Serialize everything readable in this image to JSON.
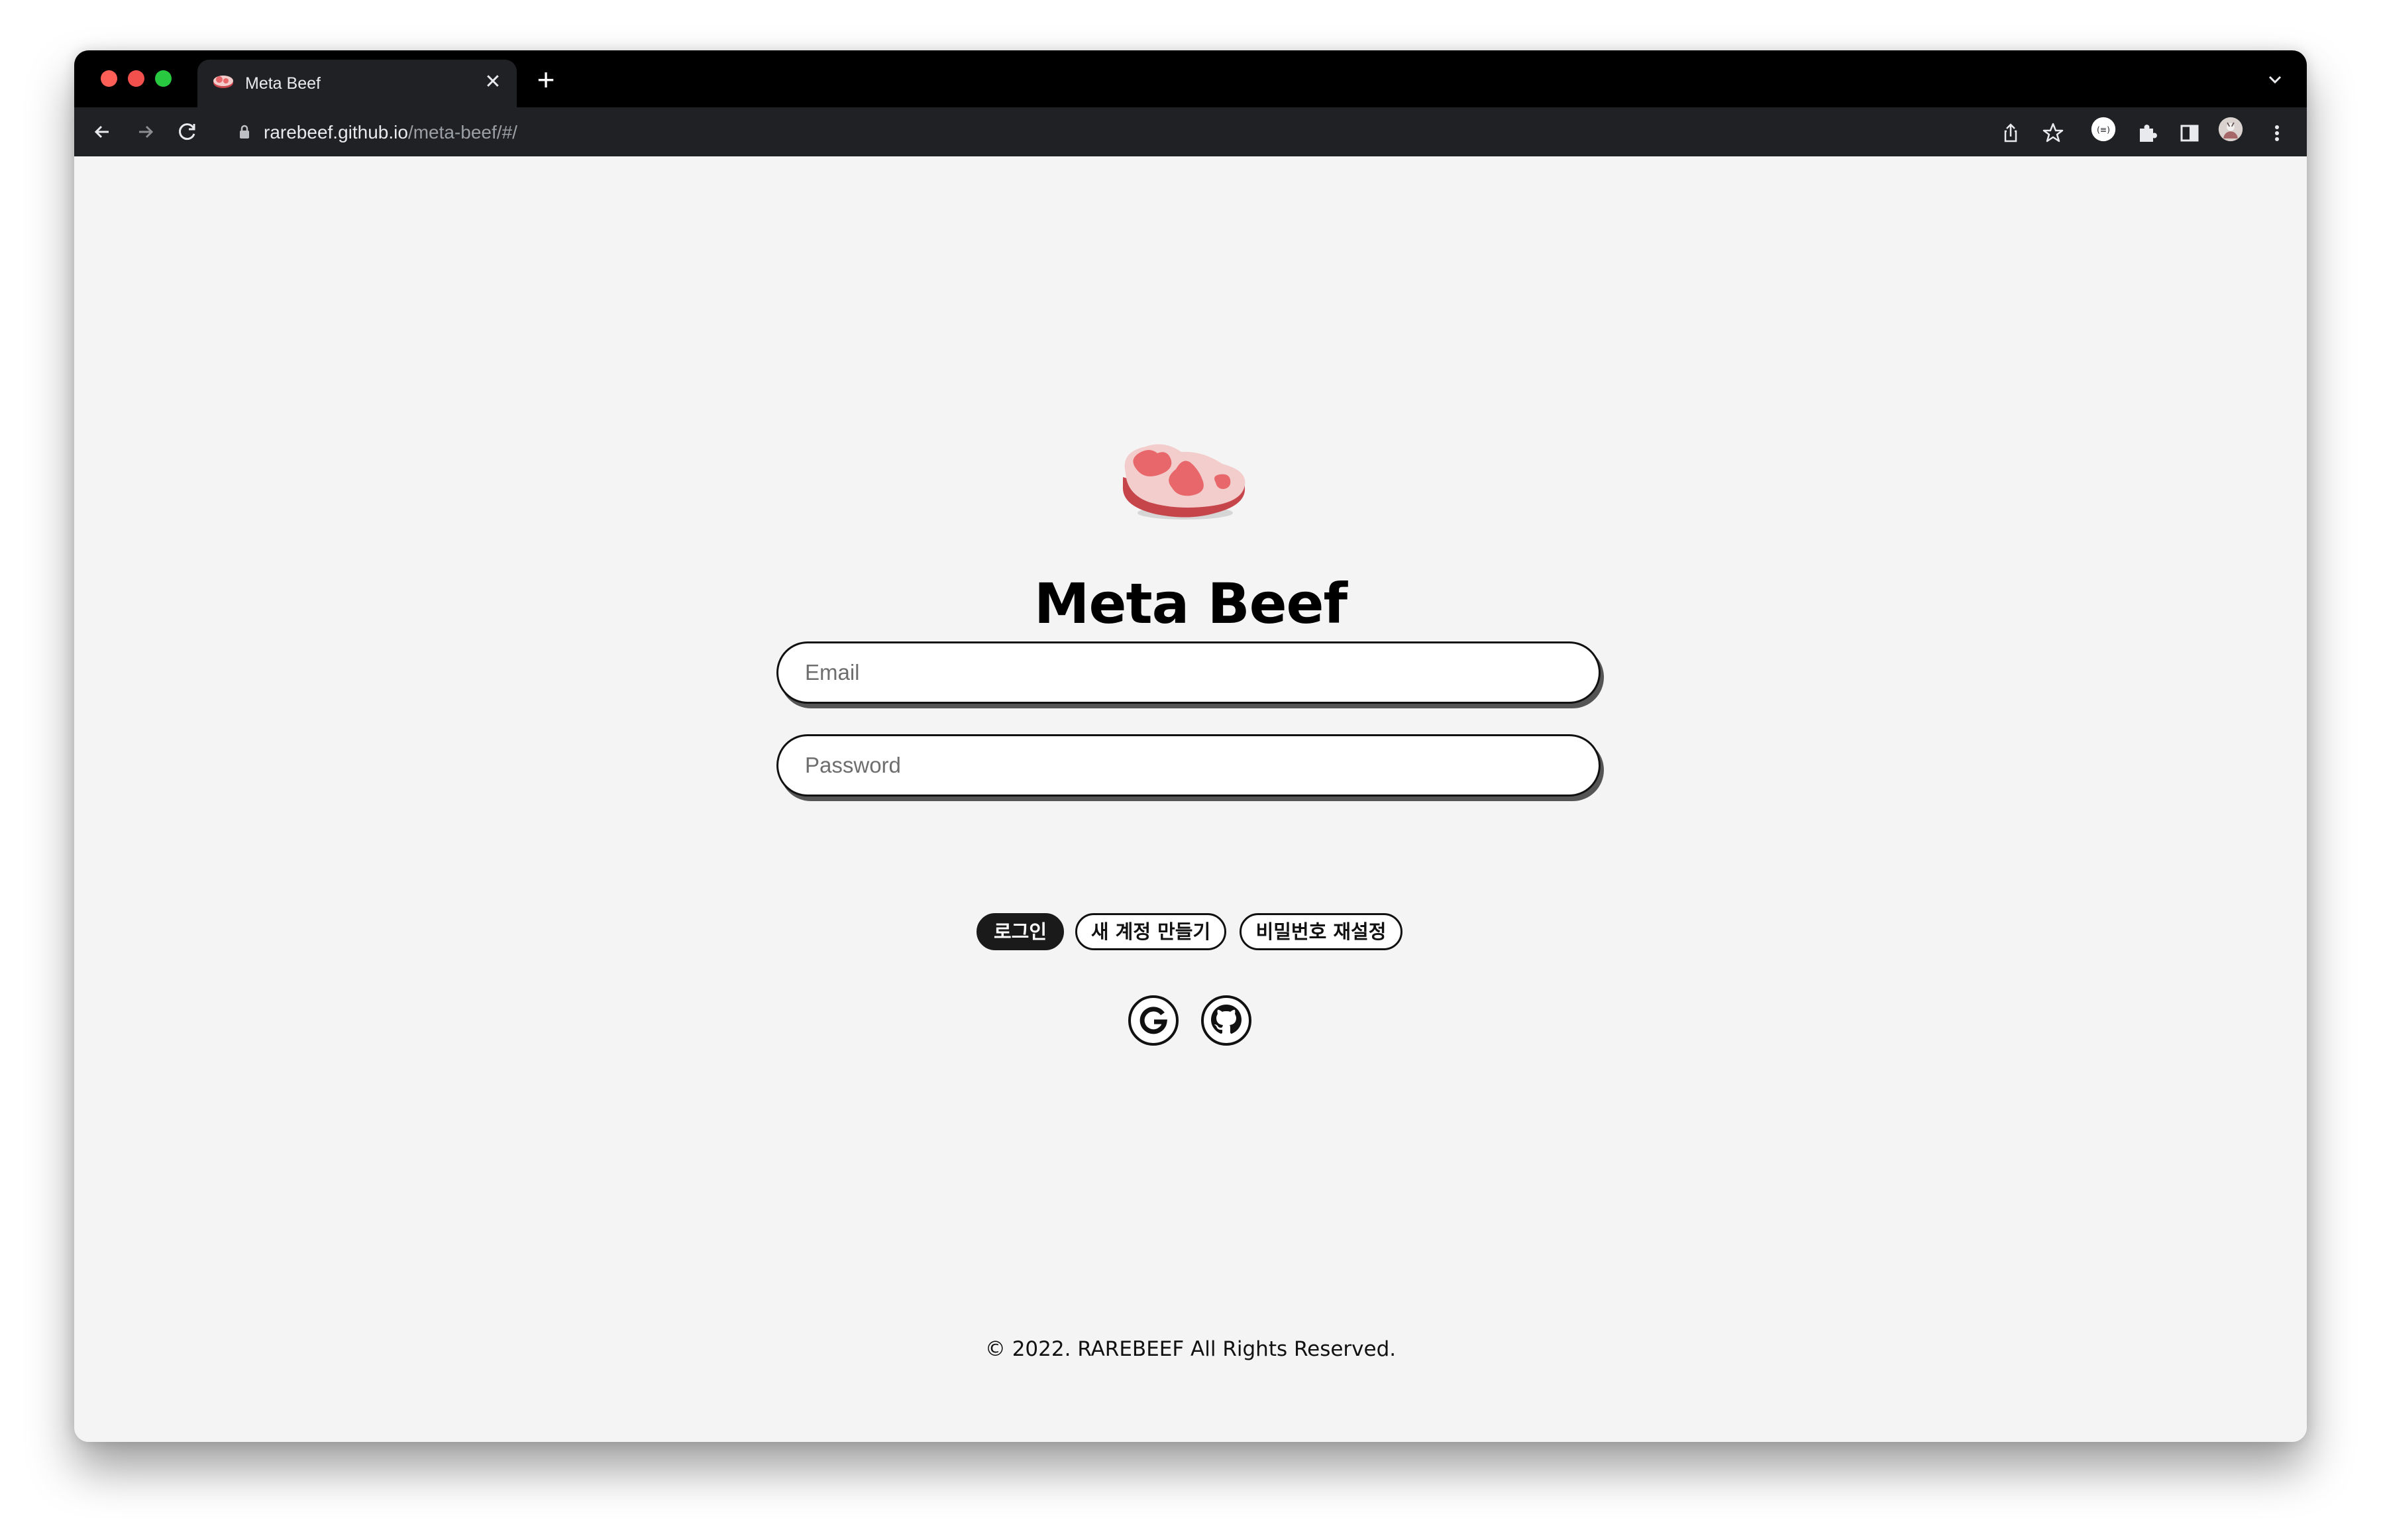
{
  "browser": {
    "tab": {
      "title": "Meta Beef",
      "close_glyph": "✕",
      "favicon": "steak-icon"
    },
    "new_tab_glyph": "+",
    "url": {
      "host": "rarebeef.github.io",
      "path": "/meta-beef/#/"
    },
    "toolbar_icons": [
      "back-icon",
      "forward-icon",
      "reload-icon",
      "lock-icon",
      "share-icon",
      "bookmark-star-icon",
      "extension-badge-icon",
      "puzzle-icon",
      "side-panel-icon",
      "profile-avatar",
      "kebab-menu-icon"
    ]
  },
  "page": {
    "logo": "steak-icon",
    "title": "Meta Beef",
    "form": {
      "email_placeholder": "Email",
      "email_value": "",
      "password_placeholder": "Password",
      "password_value": ""
    },
    "buttons": {
      "login": "로그인",
      "signup": "새 계정 만들기",
      "reset_password": "비밀번호 재설정"
    },
    "social": [
      "google-icon",
      "github-icon"
    ],
    "footer": "© 2022. RAREBEEF All Rights Reserved."
  },
  "colors": {
    "steak_meat": "#e8676a",
    "steak_fat": "#f3cccc",
    "steak_edge": "#c6454a",
    "page_bg": "#f4f4f4",
    "button_dark": "#1a1a1a"
  }
}
